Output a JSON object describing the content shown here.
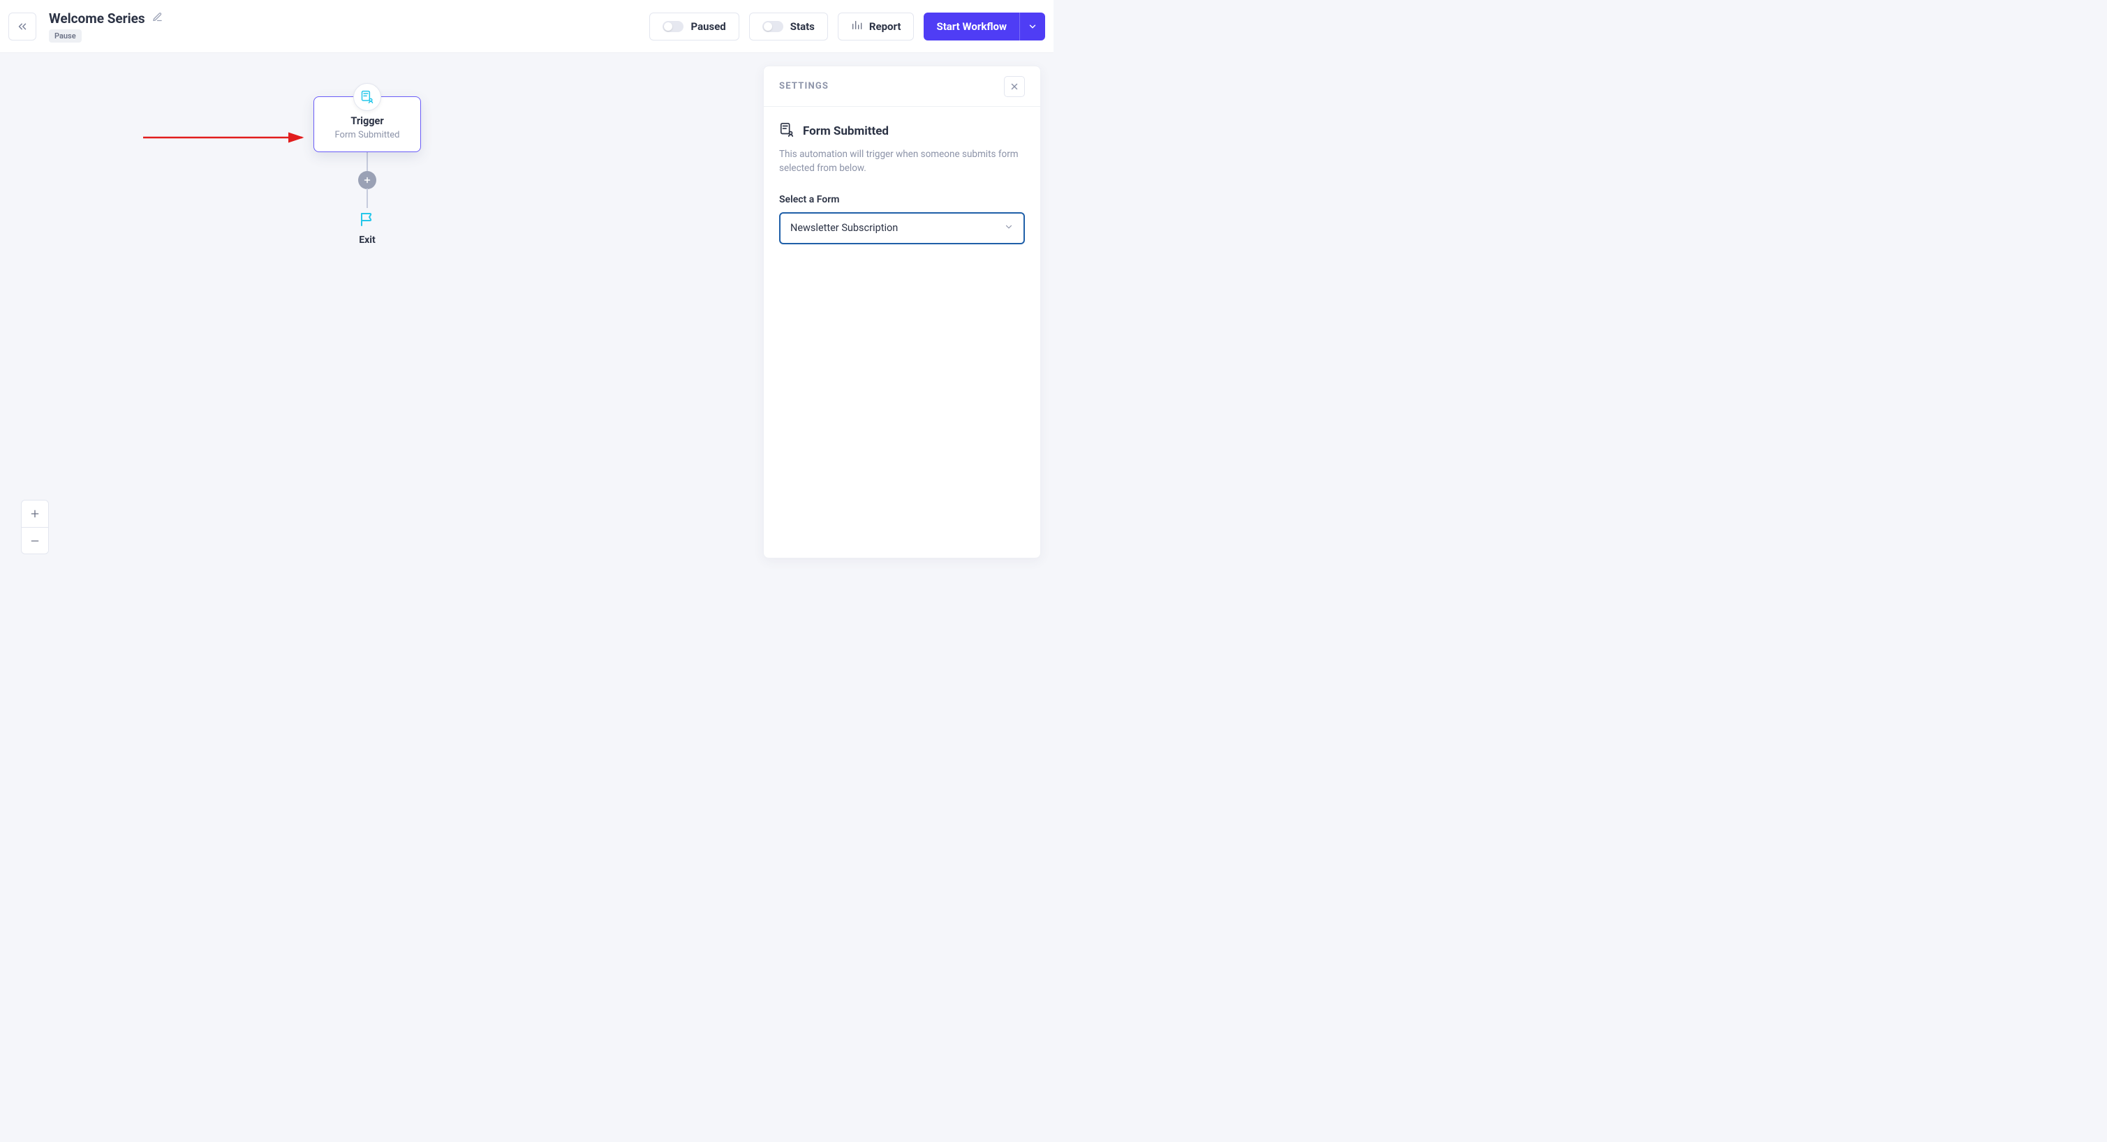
{
  "header": {
    "title": "Welcome Series",
    "status_badge": "Pause",
    "paused_label": "Paused",
    "stats_label": "Stats",
    "report_label": "Report",
    "start_label": "Start Workflow"
  },
  "workflow": {
    "trigger": {
      "title": "Trigger",
      "subtitle": "Form Submitted"
    },
    "exit_label": "Exit"
  },
  "settings": {
    "panel_title": "SETTINGS",
    "section_heading": "Form Submitted",
    "description": "This automation will trigger when someone submits form selected from below.",
    "select_label": "Select a Form",
    "selected_form": "Newsletter Subscription"
  },
  "icons": {
    "back": "chevrons-left-icon",
    "edit": "pencil-icon",
    "bars": "bar-chart-icon",
    "form": "form-user-icon",
    "flag": "flag-icon",
    "close": "x-icon",
    "chevron_down": "chevron-down-icon",
    "plus": "plus-icon",
    "minus": "minus-icon"
  },
  "annotations": {
    "arrow_left_color": "#e11d1d",
    "arrow_up_color": "#e11d1d"
  }
}
